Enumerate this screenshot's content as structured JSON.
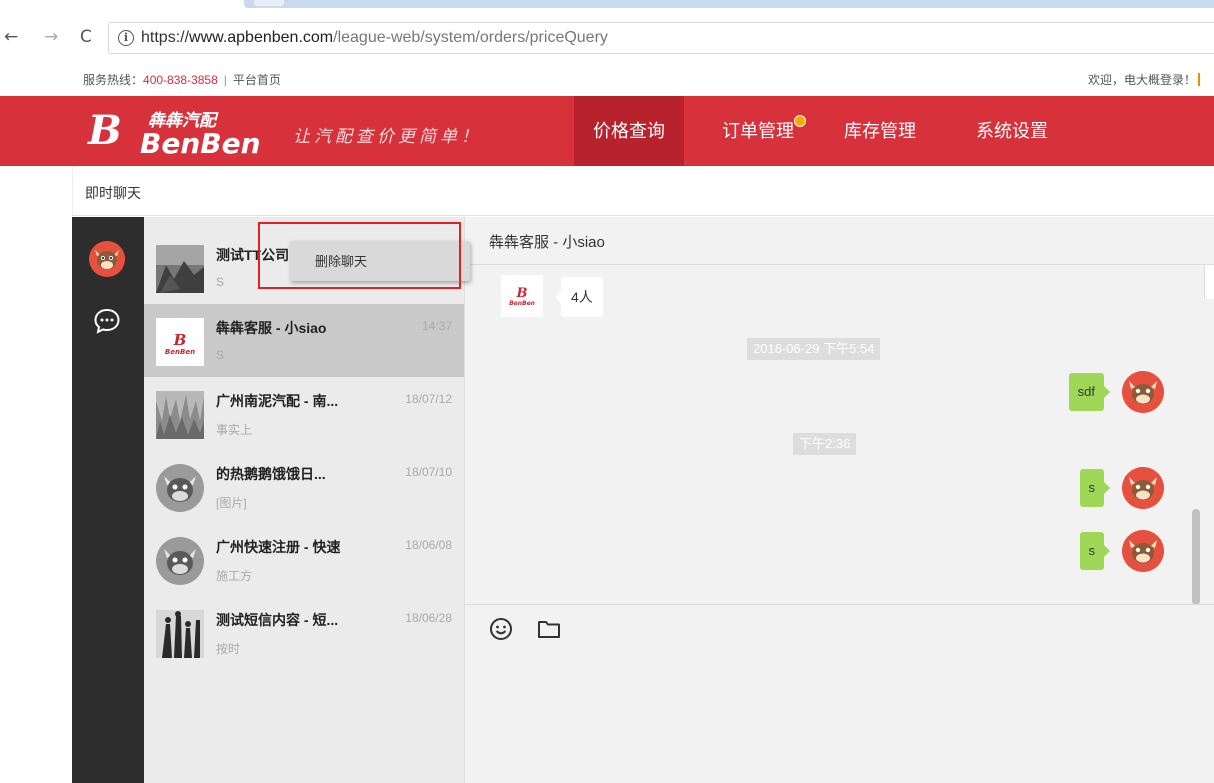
{
  "browser": {
    "url_scheme": "https://",
    "url_host": "www.apbenben.com",
    "url_path": "/league-web/system/orders/priceQuery",
    "back_glyph": "←",
    "forward_glyph": "→",
    "reload_glyph": "C",
    "info_glyph": "i"
  },
  "service_line": {
    "label": "服务热线：",
    "phone": "400-838-3858",
    "separator": "|",
    "home_link": "平台首页",
    "welcome": "欢迎，电大概登录！"
  },
  "header": {
    "logo_mark": "B",
    "logo_cn": "犇犇汽配",
    "logo_en": "BenBen",
    "slogan": "让汽配查价更简单！",
    "nav": [
      {
        "label": "价格查询",
        "active": true
      },
      {
        "label": "订单管理",
        "has_notification": true
      },
      {
        "label": "库存管理"
      },
      {
        "label": "系统设置"
      }
    ],
    "brand_color": "#d7313c"
  },
  "chat_titlebar": {
    "title": "即时聊天"
  },
  "conversations": [
    {
      "name": "测试TT公司",
      "time": "",
      "preview": "S",
      "thumb": "photo-thumb"
    },
    {
      "name": "犇犇客服 - 小siao",
      "time": "14:37",
      "preview": "S",
      "thumb": "benben-logo",
      "selected": true
    },
    {
      "name": "广州南泥汽配 - 南...",
      "time": "18/07/12",
      "preview": "事实上",
      "thumb": "grass-thumb"
    },
    {
      "name": "的热鹅鹅饿饿日...",
      "time": "18/07/10",
      "preview": "[图片]",
      "thumb": "bull-avatar"
    },
    {
      "name": "广州快速注册 - 快速",
      "time": "18/06/08",
      "preview": "施工方",
      "thumb": "bull-avatar"
    },
    {
      "name": "测试短信内容 - 短...",
      "time": "18/06/28",
      "preview": "按时",
      "thumb": "people-thumb"
    }
  ],
  "context_menu": {
    "delete_label": "删除聊天"
  },
  "chat": {
    "peer_name": "犇犇客服 - 小siao",
    "group_count": "4人",
    "time_first": "2018-06-29 下午5:54",
    "time_second": "下午2:36",
    "messages": [
      {
        "text": "sdf"
      },
      {
        "text": "s"
      },
      {
        "text": "s"
      }
    ],
    "bubble_color": "#9ed856"
  },
  "icons": {
    "emoji": "smile-icon",
    "folder": "folder-icon",
    "chat": "chat-bubble-icon"
  }
}
